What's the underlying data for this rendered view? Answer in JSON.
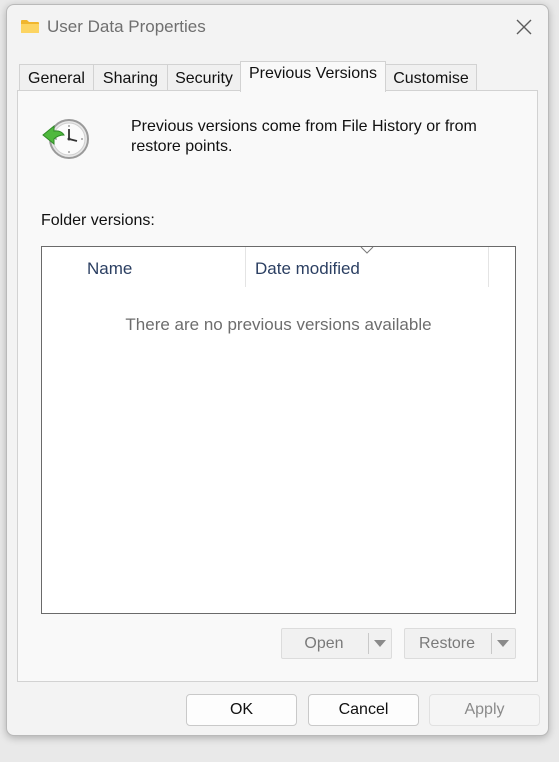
{
  "window": {
    "title": "User Data Properties"
  },
  "tabs": [
    {
      "label": "General",
      "active": false
    },
    {
      "label": "Sharing",
      "active": false
    },
    {
      "label": "Security",
      "active": false
    },
    {
      "label": "Previous Versions",
      "active": true
    },
    {
      "label": "Customise",
      "active": false
    }
  ],
  "panel": {
    "info_text": "Previous versions come from File History or from restore points.",
    "folder_versions_label": "Folder versions:",
    "list": {
      "columns": [
        "Name",
        "Date modified"
      ],
      "empty_message": "There are no previous versions available",
      "rows": []
    },
    "open_button": {
      "label": "Open",
      "enabled": false
    },
    "restore_button": {
      "label": "Restore",
      "enabled": false
    }
  },
  "footer": {
    "ok_label": "OK",
    "cancel_label": "Cancel",
    "apply_label": "Apply"
  },
  "icons": {
    "title": "folder-icon",
    "close": "close-icon",
    "info": "clock-restore-icon",
    "dropdown": "chevron-down-icon"
  },
  "colors": {
    "folder": "#f7c948",
    "restore_arrow": "#4fb83d",
    "column_header_text": "#2b3f62"
  }
}
